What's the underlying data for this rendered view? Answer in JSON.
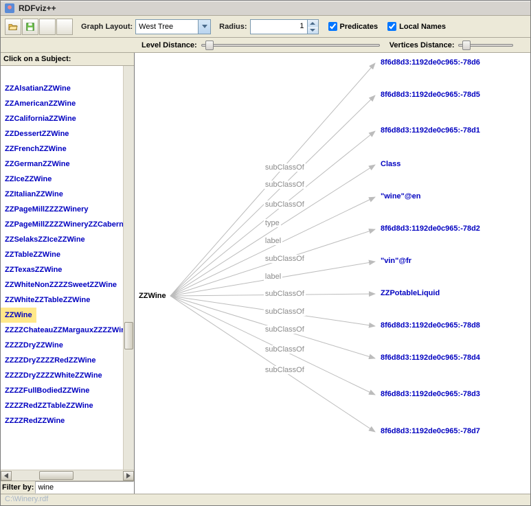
{
  "title": "RDFviz++",
  "toolbar": {
    "graph_layout_label": "Graph Layout:",
    "layout_value": "West Tree",
    "radius_label": "Radius:",
    "radius_value": "1",
    "predicates_label": "Predicates",
    "local_names_label": "Local Names"
  },
  "distances": {
    "level_label": "Level Distance:",
    "vertices_label": "Vertices Distance:"
  },
  "sidebar": {
    "title": "Click on a Subject:",
    "subjects": [
      "ZZAlsatianZZWine",
      "ZZAmericanZZWine",
      "ZZCaliforniaZZWine",
      "ZZDessertZZWine",
      "ZZFrenchZZWine",
      "ZZGermanZZWine",
      "ZZIceZZWine",
      "ZZItalianZZWine",
      "ZZPageMillZZZZWinery",
      "ZZPageMillZZZZWineryZZCabernet",
      "ZZSelaksZZIceZZWine",
      "ZZTableZZWine",
      "ZZTexasZZWine",
      "ZZWhiteNonZZZZSweetZZWine",
      "ZZWhiteZZTableZZWine",
      "ZZWine",
      "ZZZZChateauZZMargauxZZZZWine",
      "ZZZZDryZZWine",
      "ZZZZDryZZZZRedZZWine",
      "ZZZZDryZZZZWhiteZZWine",
      "ZZZZFullBodiedZZWine",
      "ZZZZRedZZTableZZWine",
      "ZZZZRedZZWine"
    ],
    "selected_index": 15,
    "filter_label": "Filter by:",
    "filter_value": "wine"
  },
  "graph": {
    "center": "ZZWine",
    "edges": [
      {
        "label": "subClassOf",
        "target": "8f6d8d3:1192de0c965:-78d6"
      },
      {
        "label": "subClassOf",
        "target": "8f6d8d3:1192de0c965:-78d5"
      },
      {
        "label": "subClassOf",
        "target": "8f6d8d3:1192de0c965:-78d1"
      },
      {
        "label": "type",
        "target": "Class"
      },
      {
        "label": "label",
        "target": "\"wine\"@en"
      },
      {
        "label": "subClassOf",
        "target": "8f6d8d3:1192de0c965:-78d2"
      },
      {
        "label": "label",
        "target": "\"vin\"@fr"
      },
      {
        "label": "subClassOf",
        "target": "ZZPotableLiquid"
      },
      {
        "label": "subClassOf",
        "target": "8f6d8d3:1192de0c965:-78d8"
      },
      {
        "label": "subClassOf",
        "target": "8f6d8d3:1192de0c965:-78d4"
      },
      {
        "label": "subClassOf",
        "target": "8f6d8d3:1192de0c965:-78d3"
      },
      {
        "label": "subClassOf",
        "target": "8f6d8d3:1192de0c965:-78d7"
      }
    ]
  },
  "statusbar": "C:\\Winery.rdf"
}
